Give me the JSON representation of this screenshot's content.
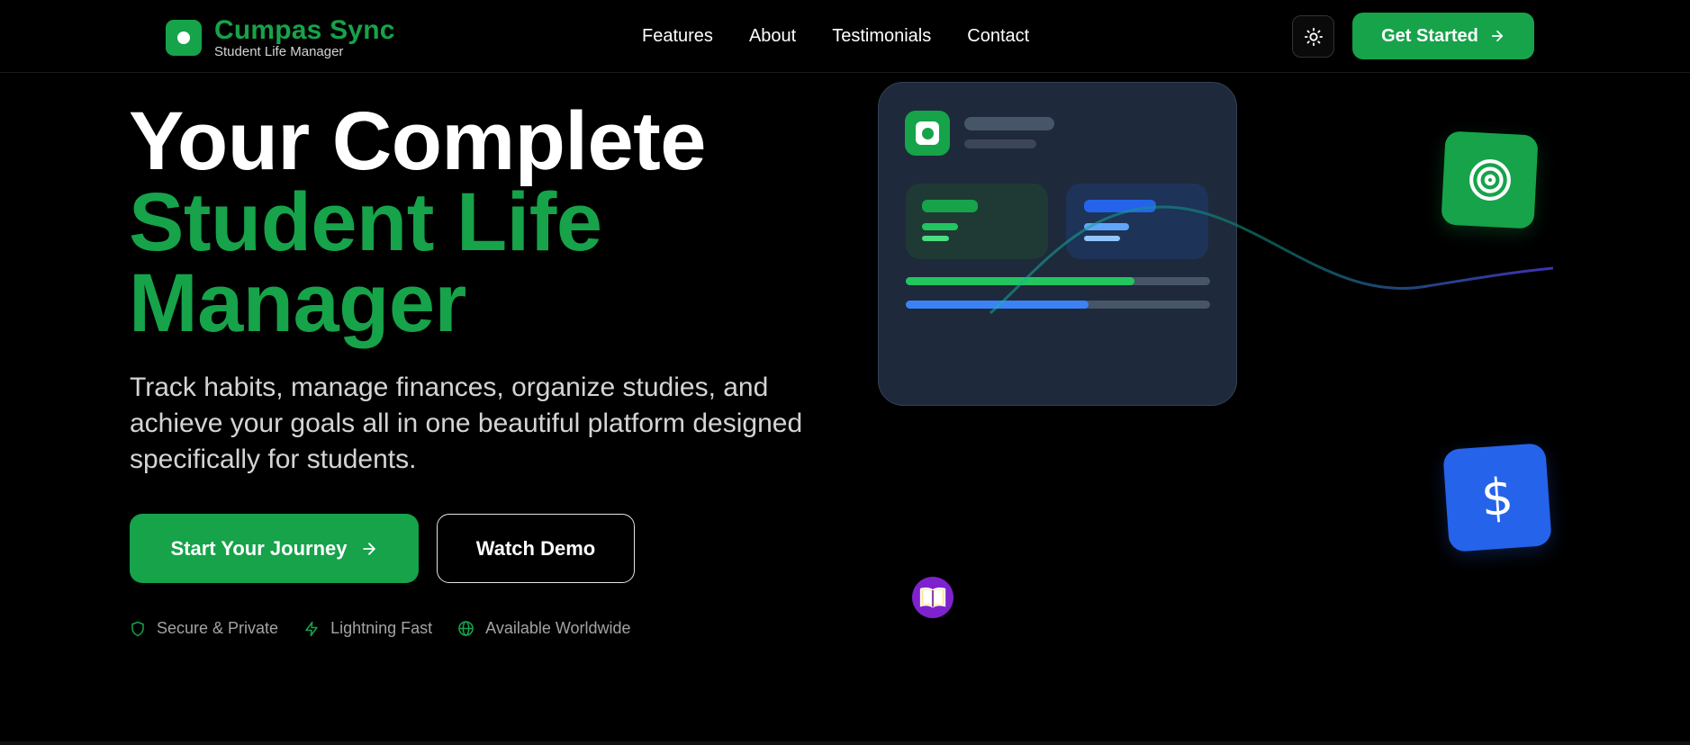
{
  "brand": {
    "name": "Cumpas Sync",
    "tagline": "Student Life Manager"
  },
  "nav": {
    "items": [
      "Features",
      "About",
      "Testimonials",
      "Contact"
    ]
  },
  "header": {
    "theme_icon": "sun-icon",
    "cta_label": "Get Started"
  },
  "hero": {
    "title_line1": "Your Complete",
    "title_line2": "Student Life",
    "title_line3": "Manager",
    "description": "Track habits, manage finances, organize studies, and achieve your goals all in one beautiful platform designed specifically for students.",
    "primary_button": "Start Your Journey",
    "secondary_button": "Watch Demo",
    "features": [
      {
        "icon": "shield-icon",
        "label": "Secure & Private"
      },
      {
        "icon": "lightning-icon",
        "label": "Lightning Fast"
      },
      {
        "icon": "globe-icon",
        "label": "Available Worldwide"
      }
    ]
  },
  "mock_card": {
    "progress_green": 0.75,
    "progress_blue": 0.6
  },
  "floating_icons": {
    "target": "target-icon",
    "dollar": "$",
    "book": "book-icon"
  },
  "colors": {
    "accent_green": "#16a34a",
    "accent_blue": "#2563eb",
    "accent_purple": "#7e22ce",
    "card_bg": "#1e293b"
  }
}
